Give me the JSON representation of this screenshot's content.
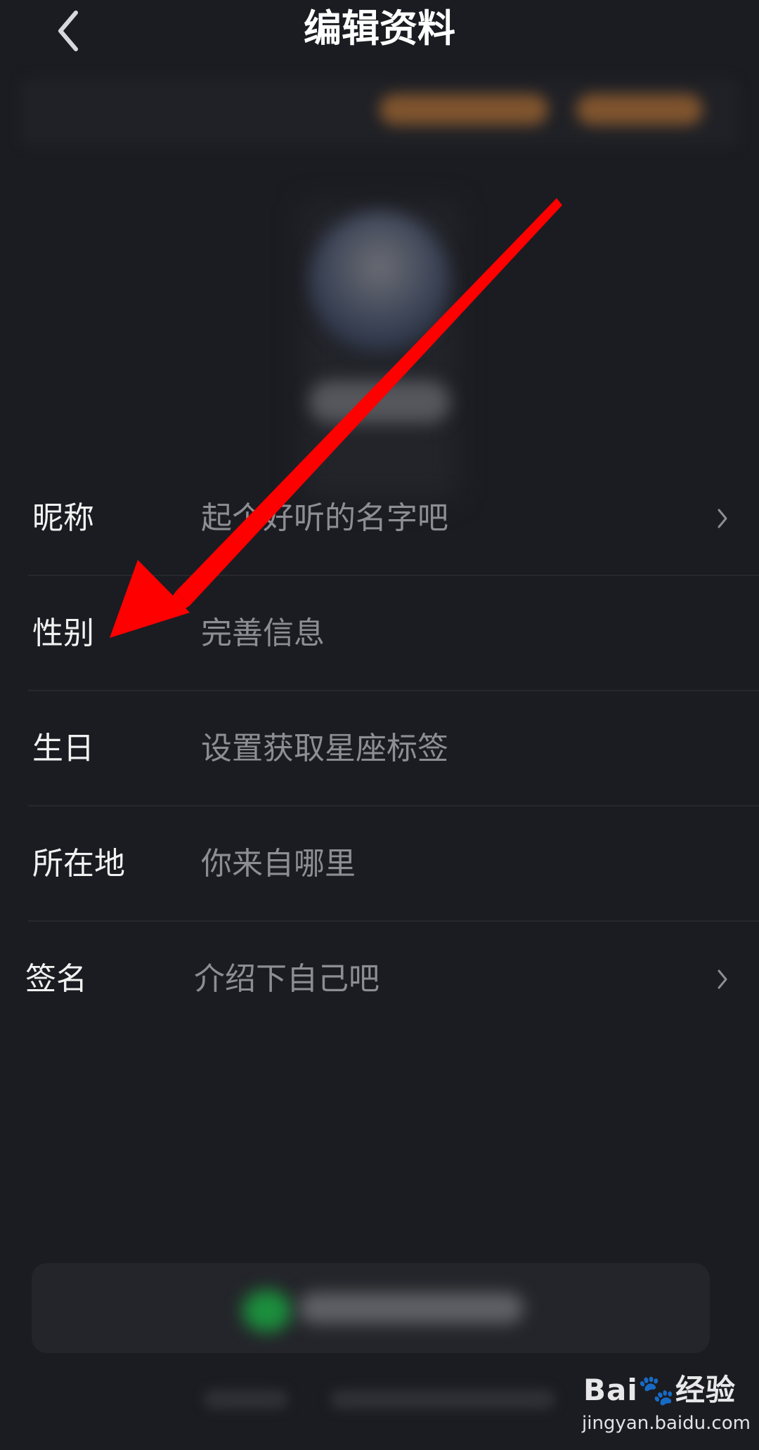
{
  "header": {
    "title": "编辑资料"
  },
  "rows": [
    {
      "label": "昵称",
      "value": "起个好听的名字吧",
      "has_chevron": true
    },
    {
      "label": "性别",
      "value": "完善信息",
      "has_chevron": false
    },
    {
      "label": "生日",
      "value": "设置获取星座标签",
      "has_chevron": false
    },
    {
      "label": "所在地",
      "value": "你来自哪里",
      "has_chevron": false
    },
    {
      "label": "签名",
      "value": "介绍下自己吧",
      "has_chevron": true
    }
  ],
  "watermark": {
    "logo": "Bai🐾经验",
    "url": "jingyan.baidu.com"
  },
  "icons": {
    "back": "chevron-left-icon",
    "row_arrow": "chevron-right-icon",
    "annotation": "red-arrow-icon"
  },
  "colors": {
    "background": "#1b1c21",
    "title": "#ffffff",
    "label": "#f2f2f2",
    "value": "#8d8e93",
    "annotation": "#ff0000"
  }
}
